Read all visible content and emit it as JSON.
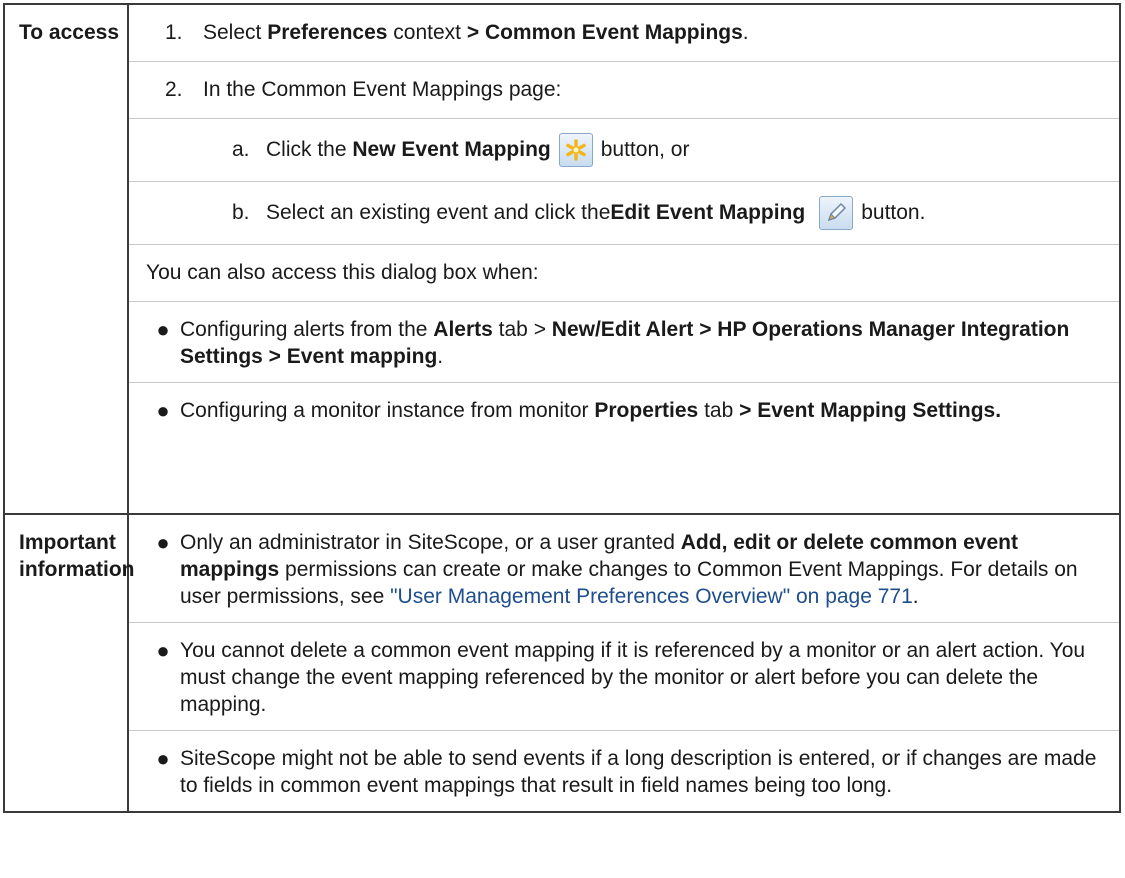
{
  "access": {
    "label": "To access",
    "step1": {
      "num": "1.",
      "pre": "Select ",
      "b1": "Preferences",
      "mid": " context ",
      "b2": "> Common Event Mappings",
      "post": "."
    },
    "step2": {
      "num": "2.",
      "text": "In the Common Event Mappings page:"
    },
    "sub_a": {
      "num": "a.",
      "pre": "Click the ",
      "b": "New Event Mapping",
      "icon": "new-star-icon",
      "post": "button, or"
    },
    "sub_b": {
      "num": "b.",
      "pre": "Select an existing event and click the ",
      "b": "Edit Event Mapping",
      "icon": "pencil-icon",
      "post": "button."
    },
    "also": "You can also access this dialog box when:",
    "bullet1": {
      "pre": "Configuring alerts from the ",
      "b1": "Alerts",
      "mid": " tab > ",
      "b2": "New/Edit Alert > HP Operations Manager Integration Settings > Event mapping",
      "post": "."
    },
    "bullet2": {
      "pre": "Configuring a monitor instance from monitor ",
      "b1": "Properties",
      "mid": " tab ",
      "b2": "> Event Mapping Settings."
    }
  },
  "important": {
    "label": "Important information",
    "bullet1": {
      "pre": "Only an administrator in SiteScope, or a user granted ",
      "b": "Add, edit or delete common event mappings",
      "mid": " permissions can create or make changes to Common Event Mappings. For details on user permissions, see ",
      "link": "\"User Management Preferences Overview\" on page 771",
      "post": "."
    },
    "bullet2": "You cannot delete a common event mapping if it is referenced by a monitor or an alert action. You must change the event mapping referenced by the monitor or alert before you can delete the mapping.",
    "bullet3": "SiteScope might not be able to send events if a long description is entered, or if changes are made to fields in common event mappings that result in field names being too long."
  },
  "colors": {
    "border": "#3a3a3a",
    "link": "#1f4e8c",
    "icon_star": "#f2b61c"
  }
}
